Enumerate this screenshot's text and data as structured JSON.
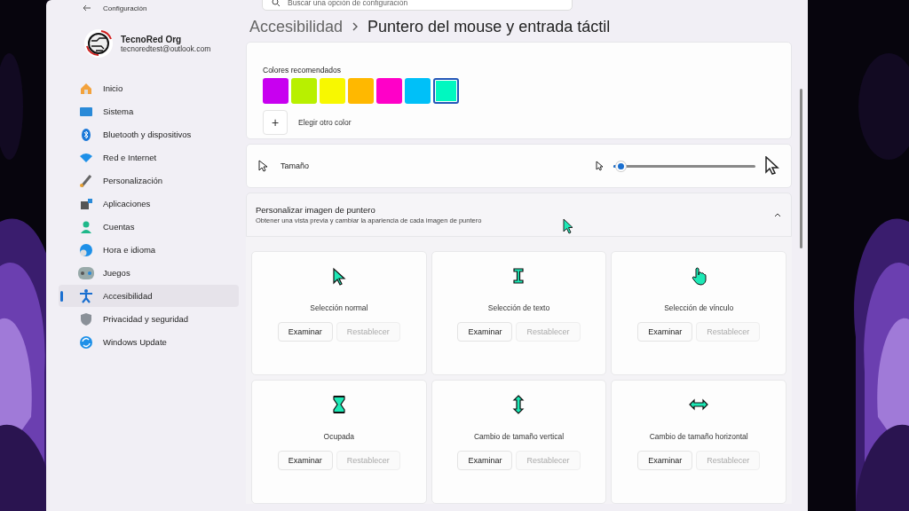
{
  "window": {
    "title": "Configuración"
  },
  "profile": {
    "name": "TecnoRed Org",
    "email": "tecnoredtest@outlook.com"
  },
  "search": {
    "placeholder": "Buscar una opción de configuración"
  },
  "sidebar": {
    "items": [
      {
        "label": "Inicio",
        "selected": false
      },
      {
        "label": "Sistema",
        "selected": false
      },
      {
        "label": "Bluetooth y dispositivos",
        "selected": false
      },
      {
        "label": "Red e Internet",
        "selected": false
      },
      {
        "label": "Personalización",
        "selected": false
      },
      {
        "label": "Aplicaciones",
        "selected": false
      },
      {
        "label": "Cuentas",
        "selected": false
      },
      {
        "label": "Hora e idioma",
        "selected": false
      },
      {
        "label": "Juegos",
        "selected": false
      },
      {
        "label": "Accesibilidad",
        "selected": true
      },
      {
        "label": "Privacidad y seguridad",
        "selected": false
      },
      {
        "label": "Windows Update",
        "selected": false
      }
    ]
  },
  "breadcrumb": {
    "parent": "Accesibilidad",
    "current": "Puntero del mouse y entrada táctil"
  },
  "colors": {
    "label": "Colores recomendados",
    "swatches": [
      {
        "color": "#c800f0",
        "selected": false
      },
      {
        "color": "#b8f000",
        "selected": false
      },
      {
        "color": "#f8f800",
        "selected": false
      },
      {
        "color": "#ffb800",
        "selected": false
      },
      {
        "color": "#ff00c8",
        "selected": false
      },
      {
        "color": "#00c0f8",
        "selected": false
      },
      {
        "color": "#00f8c0",
        "selected": true
      }
    ],
    "add_button": "+",
    "custom_label": "Elegir otro color"
  },
  "size": {
    "label": "Tamaño",
    "level": 0.05
  },
  "pointer_images": {
    "title": "Personalizar imagen de puntero",
    "subtitle": "Obtener una vista previa y cambiar la apariencia de cada imagen de puntero",
    "expanded": true,
    "cards": [
      {
        "label": "Selección normal",
        "buttons": [
          {
            "label": "Examinar",
            "disabled": false
          },
          {
            "label": "Restablecer",
            "disabled": true
          }
        ]
      },
      {
        "label": "Selección de texto",
        "buttons": [
          {
            "label": "Examinar",
            "disabled": false
          },
          {
            "label": "Restablecer",
            "disabled": true
          }
        ]
      },
      {
        "label": "Selección de vínculo",
        "buttons": [
          {
            "label": "Examinar",
            "disabled": false
          },
          {
            "label": "Restablecer",
            "disabled": true
          }
        ]
      },
      {
        "label": "Ocupada",
        "buttons": [
          {
            "label": "Examinar",
            "disabled": false
          },
          {
            "label": "Restablecer",
            "disabled": true
          }
        ]
      },
      {
        "label": "Cambio de tamaño vertical",
        "buttons": [
          {
            "label": "Examinar",
            "disabled": false
          },
          {
            "label": "Restablecer",
            "disabled": true
          }
        ]
      },
      {
        "label": "Cambio de tamaño horizontal",
        "buttons": [
          {
            "label": "Examinar",
            "disabled": false
          },
          {
            "label": "Restablecer",
            "disabled": true
          }
        ]
      }
    ]
  }
}
